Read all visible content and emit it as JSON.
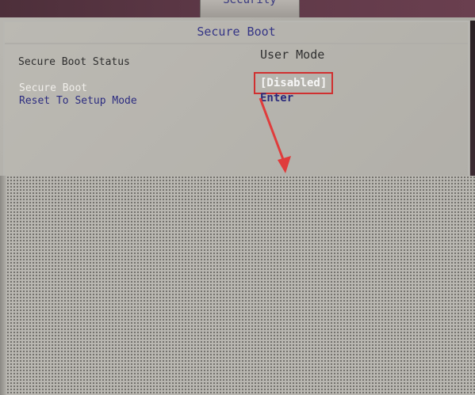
{
  "header": {
    "active_tab": "Security"
  },
  "panel": {
    "title": "Secure Boot",
    "rows": [
      {
        "label": "Secure Boot Status",
        "value": "User Mode"
      },
      {
        "label": "Secure Boot",
        "value": "[Disabled]"
      },
      {
        "label": "Reset To Setup Mode",
        "value": "Enter"
      }
    ]
  },
  "annotation": {
    "highlight_color": "#d03030",
    "arrow_color": "#e03c3c"
  }
}
